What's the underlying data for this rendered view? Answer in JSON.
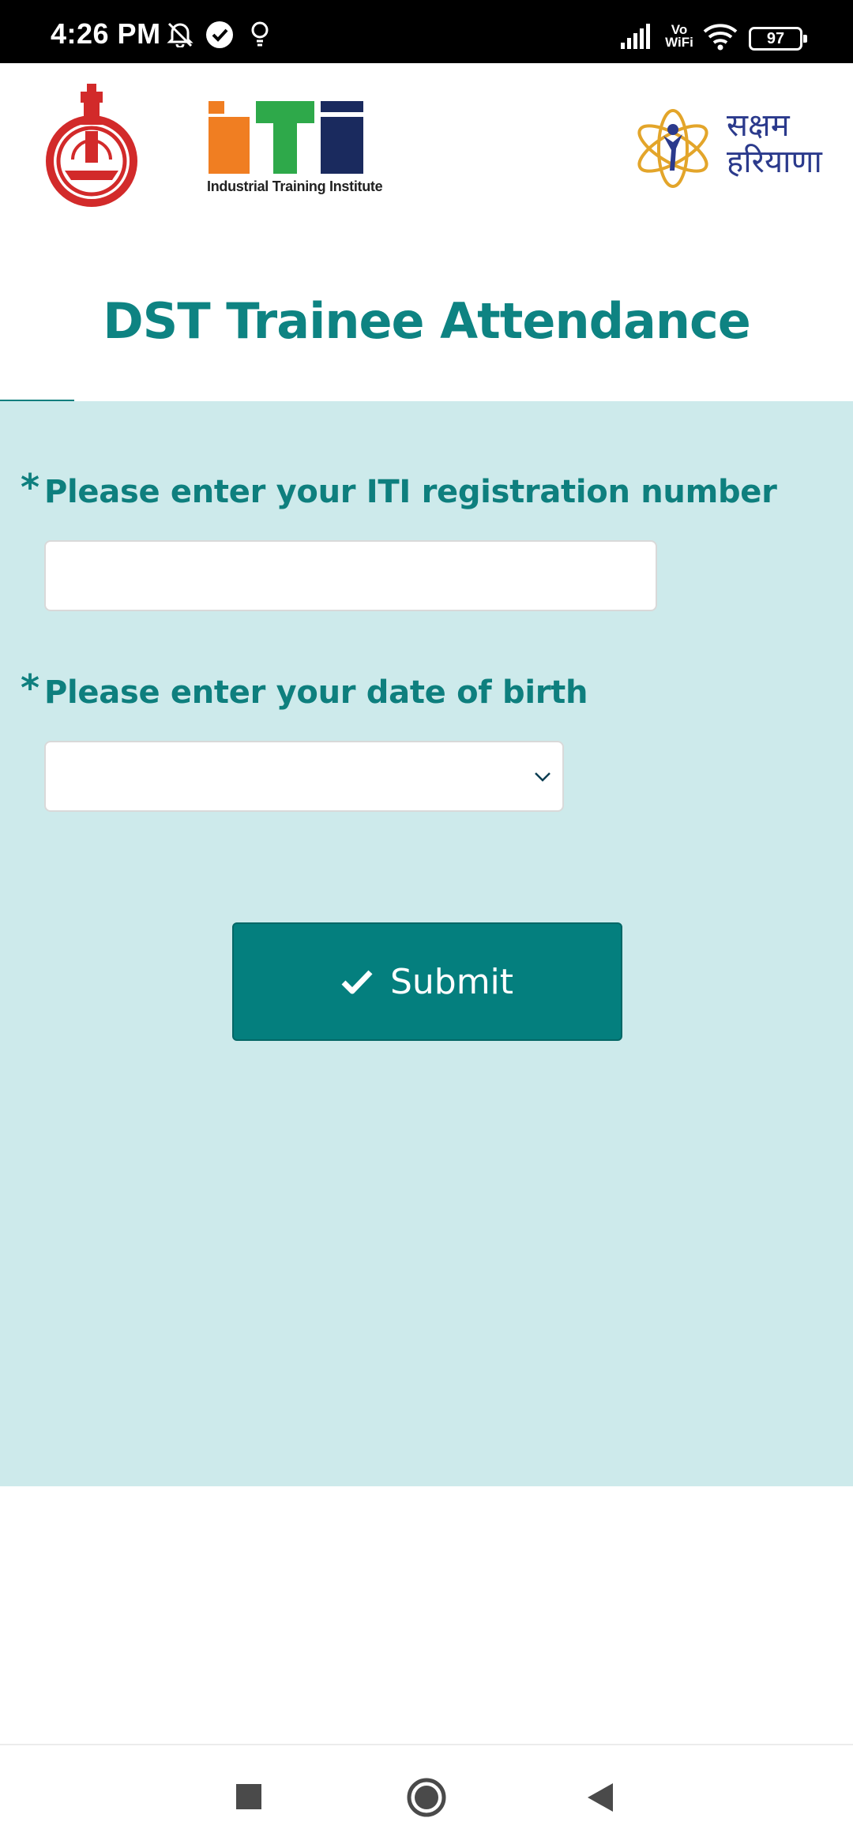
{
  "status_bar": {
    "time": "4:26 PM",
    "icons": [
      "mute-icon",
      "check-circle-icon",
      "bulb-icon",
      "signal-icon",
      "vowifi-icon",
      "wifi-icon"
    ],
    "vowifi_label": "Vo WiFi",
    "battery": "97"
  },
  "header": {
    "logos": [
      "haryana-emblem",
      "iti-logo",
      "saksham-haryana-logo"
    ],
    "iti_caption": "Industrial Training Institute",
    "saksham_line1": "सक्षम",
    "saksham_line2": "हरियाणा"
  },
  "page": {
    "title": "DST Trainee Attendance"
  },
  "form": {
    "required_mark": "*",
    "registration_label": "Please enter your ITI registration number",
    "registration_value": "",
    "dob_label": "Please enter your date of birth",
    "dob_value": "",
    "submit_label": "Submit"
  },
  "colors": {
    "accent": "#0e8382",
    "panel": "#cdeaeb",
    "button": "#047f7e"
  },
  "nav_bar": {
    "buttons": [
      "recents-square-icon",
      "home-circle-icon",
      "back-triangle-icon"
    ]
  }
}
